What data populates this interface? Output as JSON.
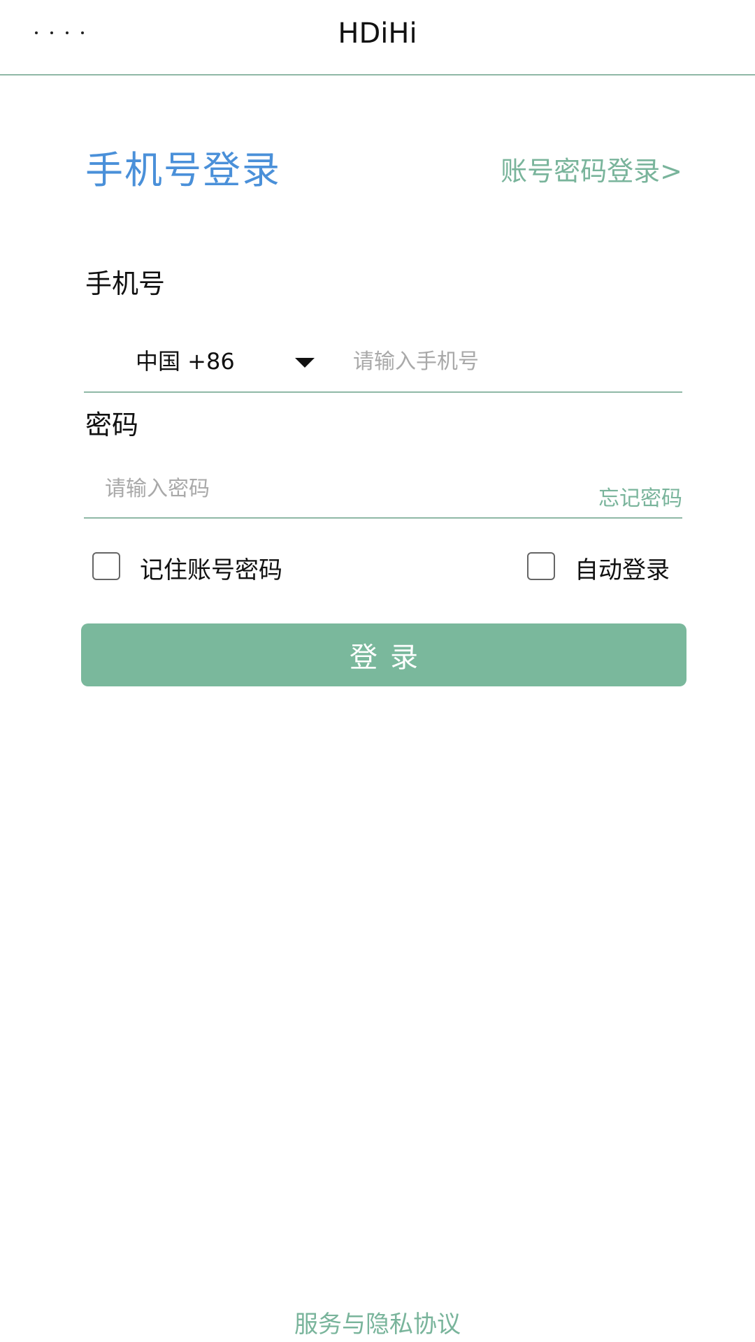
{
  "header": {
    "menu_icon": "more-dots-icon",
    "title": "HDiHi"
  },
  "login": {
    "title": "手机号登录",
    "switch_link": "账号密码登录>",
    "phone_label": "手机号",
    "country_code": "中国 +86",
    "country_dropdown_icon": "caret-down-icon",
    "phone_placeholder": "请输入手机号",
    "password_label": "密码",
    "password_placeholder": "请输入密码",
    "forgot_password": "忘记密码",
    "remember_label": "记住账号密码",
    "remember_checked": false,
    "auto_login_label": "自动登录",
    "auto_login_checked": false,
    "submit_label": "登录"
  },
  "footer": {
    "policy_link": "服务与隐私协议"
  },
  "colors": {
    "accent_green": "#7ab89c",
    "title_blue": "#4a90d9",
    "divider": "#8fb8a6"
  }
}
